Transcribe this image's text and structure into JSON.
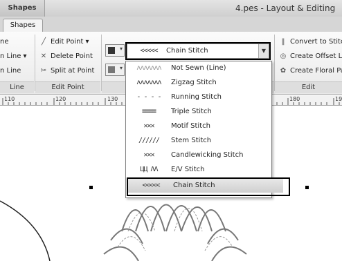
{
  "titlebar": {
    "context_label": "Shapes",
    "window_title": "4.pes - Layout & Editing"
  },
  "tabs": [
    {
      "label": "Shapes"
    }
  ],
  "ribbon": {
    "line_group": {
      "items": [
        "ne",
        "n Line ▾",
        "n Line"
      ],
      "label": "Line"
    },
    "edit_point_group": {
      "items": [
        "Edit Point ▾",
        "Delete Point",
        "Split at Point"
      ],
      "label": "Edit Point"
    },
    "stitch_combo": {
      "glyph": "<<<<<",
      "value": "Chain Stitch"
    },
    "edit_group": {
      "items": [
        "Convert to Stitc",
        "Create Offset L",
        "Create Floral Pa"
      ],
      "label": "Edit"
    }
  },
  "ruler": {
    "labels": [
      "110",
      "120",
      "130",
      "180",
      "190"
    ]
  },
  "stitch_menu": {
    "items": [
      {
        "glyph": "ʌʌʌʌʌʌʌ",
        "label": "Not Sewn (Line)"
      },
      {
        "glyph": "ʌʌʌʌʌʌʌ",
        "label": "Zigzag Stitch"
      },
      {
        "glyph": "- - - -",
        "label": "Running Stitch"
      },
      {
        "glyph": "≡≡≡≡",
        "label": "Triple Stitch"
      },
      {
        "glyph": "✕✕✕",
        "label": "Motif Stitch"
      },
      {
        "glyph": "//////",
        "label": "Stem Stitch"
      },
      {
        "glyph": "✕✕✕",
        "label": "Candlewicking Stitch"
      },
      {
        "glyph": "ЦЦ ΛΛ",
        "label": "E/V Stitch"
      },
      {
        "glyph": "<<<<<",
        "label": "Chain Stitch"
      }
    ],
    "selected": "Chain Stitch"
  }
}
